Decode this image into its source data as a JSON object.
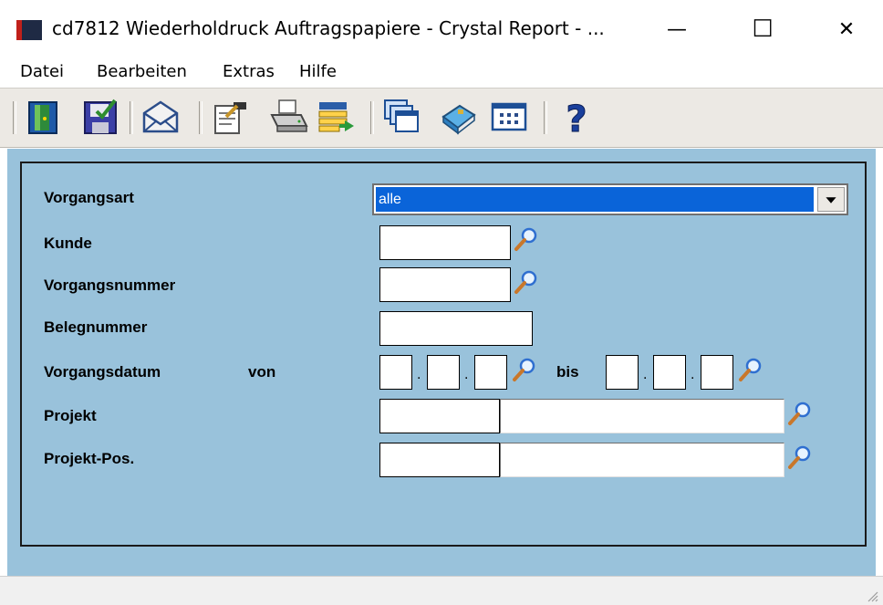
{
  "window": {
    "title": "cd7812 Wiederholdruck Auftragspapiere - Crystal Report - ...",
    "minimize": "—",
    "maximize": "☐",
    "close": "✕"
  },
  "menu": [
    "Datei",
    "Bearbeiten",
    "Extras",
    "Hilfe"
  ],
  "toolbar": {
    "icons": [
      "exit-door-icon",
      "save-icon",
      "mail-icon",
      "edit-document-icon",
      "printer-icon",
      "export-icon",
      "windows-icon",
      "book-icon",
      "table-icon",
      "help-icon"
    ]
  },
  "form": {
    "vorgangsart": {
      "label": "Vorgangsart",
      "value": "alle"
    },
    "kunde": {
      "label": "Kunde",
      "value": ""
    },
    "vorgangsnummer": {
      "label": "Vorgangsnummer",
      "value": ""
    },
    "belegnummer": {
      "label": "Belegnummer",
      "value": ""
    },
    "vorgangsdatum": {
      "label": "Vorgangsdatum",
      "von_label": "von",
      "bis_label": "bis",
      "separator": ".",
      "von": [
        "",
        "",
        ""
      ],
      "bis": [
        "",
        "",
        ""
      ]
    },
    "projekt": {
      "label": "Projekt",
      "value": "",
      "description": ""
    },
    "projekt_pos": {
      "label": "Projekt-Pos.",
      "value": "",
      "description": ""
    }
  },
  "colors": {
    "panel": "#99c2db",
    "selection": "#0a64d9"
  }
}
